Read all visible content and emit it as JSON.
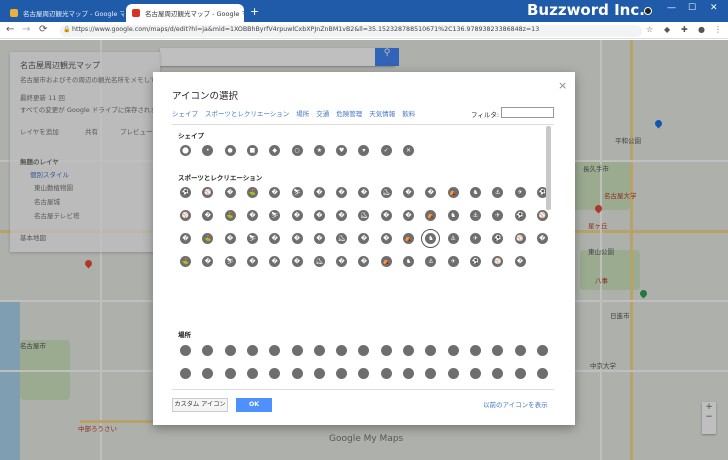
{
  "browser": {
    "tabs": [
      {
        "title": "名古屋周辺観光マップ - Google マ",
        "active": false
      },
      {
        "title": "名古屋周辺観光マップ - Google マ",
        "active": true
      }
    ],
    "new_tab": "+",
    "brand": "Buzzword Inc.",
    "window_controls": [
      "—",
      "☐",
      "✕"
    ],
    "url": "https://www.google.com/maps/d/edit?hl=ja&mid=1XOBBhByrfV4rpuwlCxbXPJnZnBM1vB2&ll=35.152328788510671%2C136.97893823386848z=13"
  },
  "map": {
    "panel": {
      "title": "名古屋周辺観光マップ",
      "desc1": "名古屋市およびその周辺の観光名所をメモしておきます。",
      "date": "最終更新 11 回",
      "notice": "すべての変更が Google ドライブに保存されました",
      "add_layer": "レイヤを追加",
      "share": "共有",
      "preview": "プレビュー",
      "layer_name": "無題のレイヤ",
      "layer_style": "個別スタイル",
      "items": [
        "東山動植物園",
        "名古屋城",
        "名古屋テレビ塔"
      ],
      "base_map": "基本地図"
    },
    "labels": [
      "長久手市",
      "名古屋大学",
      "日進市",
      "名古屋市",
      "星ヶ丘",
      "平和公園",
      "八事",
      "中部ろうさい",
      "中京大学",
      "東山公園"
    ],
    "attribution": "Google My Maps"
  },
  "dialog": {
    "title": "アイコンの選択",
    "close": "×",
    "tabs": [
      "シェイプ",
      "スポーツとレクリエーション",
      "場所",
      "交通",
      "危険管理",
      "天気情報",
      "飲料"
    ],
    "filter_label": "フィルタ:",
    "filter_value": "",
    "sections": {
      "shapes": "シェイプ",
      "sports": "スポーツとレクリエーション",
      "places": "場所"
    },
    "custom_button": "カスタム アイコン",
    "ok_button": "OK",
    "old_icons_link": "以前のアイコンを表示"
  },
  "icons": {
    "shapes": [
      "pin-icon",
      "small-dot-icon",
      "dot-icon",
      "square-icon",
      "diamond-icon",
      "circle-icon",
      "star-icon",
      "heart-icon",
      "drop-icon",
      "check-icon",
      "cross-icon"
    ],
    "sports_count": 67,
    "places_count": 34,
    "selected_sport_index": 45
  },
  "colors": {
    "titlebar": "#1f5ba8",
    "icon_gray": "#6e6e6e",
    "link_blue": "#4275c8",
    "ok_blue": "#4d90fe"
  }
}
